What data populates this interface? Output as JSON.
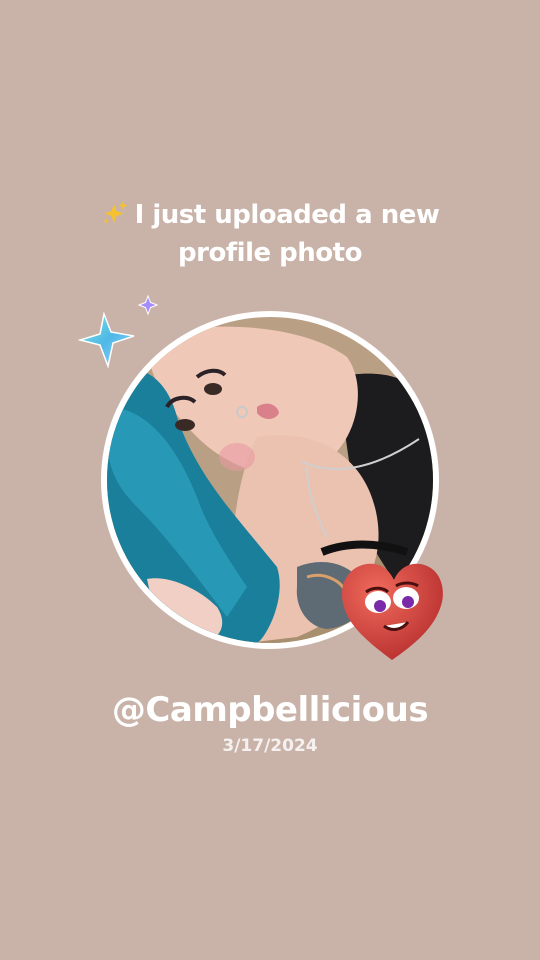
{
  "post": {
    "headline_line1": "I just uploaded a new",
    "headline_line2": "profile photo",
    "headline_emoji": "sparkles-icon",
    "username": "@Campbellicious",
    "date": "3/17/2024"
  },
  "stickers": {
    "stars": "sparkle-stars-icon",
    "heart": "heart-face-icon"
  },
  "colors": {
    "background": "#c9b3a9",
    "text": "#ffffff",
    "photo_border": "#ffffff",
    "heart": "#d9463f"
  }
}
